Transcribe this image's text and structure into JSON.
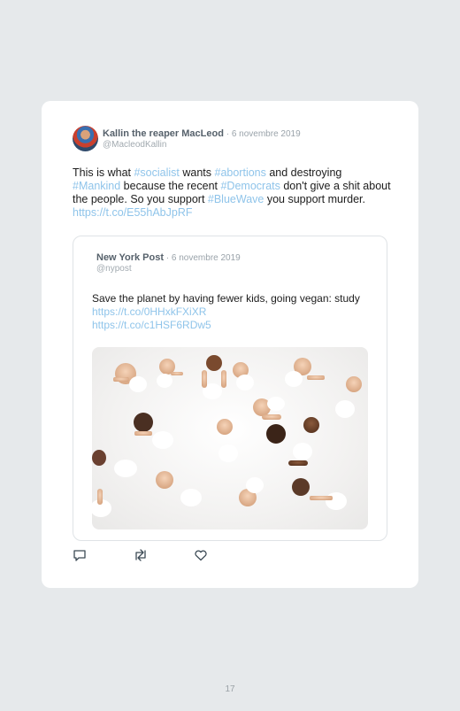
{
  "tweet": {
    "author_name": "Kallin the reaper MacLeod",
    "date": " · 6 novembre 2019",
    "handle": "@MacleodKallin",
    "text_1": "This is what ",
    "tag_socialist": "#socialist",
    "text_2": " wants ",
    "tag_abortions": "#abortions",
    "text_3": " and destroying ",
    "tag_mankind": "#Mankind",
    "text_4": " because the recent ",
    "tag_democrats": "#Democrats",
    "text_5": " don't give a shit about the people. So you support ",
    "tag_bluewave": "#BlueWave",
    "text_6": " you support murder. ",
    "url": "https://t.co/E55hAbJpRF"
  },
  "quoted": {
    "author_name": "New York Post",
    "date": " · 6 novembre 2019",
    "handle": "@nypost",
    "text_1": "Save the planet by having fewer kids, going vegan: study ",
    "url_1": "https://t.co/0HHxkFXiXR",
    "url_2": "https://t.co/c1HSF6RDw5"
  },
  "actions": {
    "reply_icon": "reply-icon",
    "retweet_icon": "retweet-icon",
    "like_icon": "heart-icon"
  },
  "page_number": "17",
  "colors": {
    "link": "#8fc4ea",
    "background": "#e6e9eb",
    "card": "#ffffff"
  }
}
